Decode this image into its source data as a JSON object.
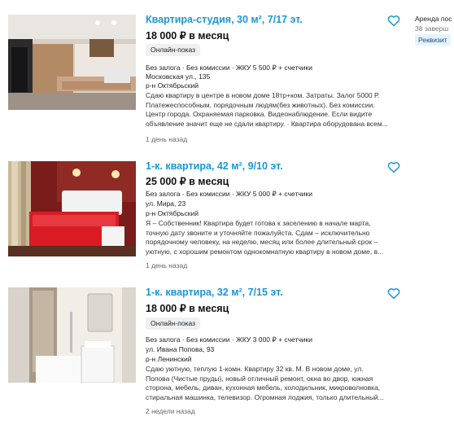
{
  "listings": [
    {
      "title": "Квартира-студия, 30 м², 7/17 эт.",
      "price": "18 000 ₽ в месяц",
      "badge": "Онлайн-показ",
      "terms": "Без залога · Без комиссии · ЖКУ 5 500 ₽ + счетчики",
      "address": "Московская ул., 135",
      "district": "р-н Октябрьский",
      "description": [
        "Сдаю квартиру в центре в новом доме 18тр+ком. Затраты. Залог 5000 Р.",
        "Платежеспособным, порядочным людям(без животных). Без комиссии.",
        "Центр города. Охраняемая парковка. Видеонаблюдение. Если видите",
        "объявление значит еще не сдали квартиру. · Квартира оборудована всем..."
      ],
      "time_ago": "1 день назад",
      "favorite_icon": "heart-outline-icon"
    },
    {
      "title": "1-к. квартира, 42 м², 9/10 эт.",
      "price": "25 000 ₽ в месяц",
      "terms": "Без залога · Без комиссии · ЖКУ 5 000 ₽ + счетчики",
      "address": "ул. Мира, 23",
      "district": "р-н Октябрьский",
      "description": [
        "Я – Собственник! Квартира будет готова к заселению в начале марта,",
        "точную дату звоните и уточняйте пожалуйста. Сдам – исключительно",
        "порядочному человеку, на неделю, месяц или более длительный срок –",
        "уютную, с хорошим ремонтом однокомнатную квартиру в новом доме, в..."
      ],
      "time_ago": "1 день назад",
      "favorite_icon": "heart-outline-icon"
    },
    {
      "title": "1-к. квартира, 32 м², 7/15 эт.",
      "price": "18 000 ₽ в месяц",
      "badge": "Онлайн-показ",
      "terms": "Без залога · Без комиссии · ЖКУ 3 000 ₽ + счетчики",
      "address": "ул. Ивана Попова, 93",
      "district": "р-н Ленинский",
      "description": [
        "Сдаю уютную, теплую 1-комн. Квартиру 32 кв. М. В новом доме, ул.",
        "Попова (Чистые пруды), новый отличный ремонт, окна во двор, южная",
        "сторона, мебель, диван, кухонная мебель, холодильник, микроволновка,",
        "стиральная машинка, телевизор. Огромная лоджия, только длительный..."
      ],
      "time_ago": "2 недели назад",
      "favorite_icon": "heart-outline-icon"
    }
  ],
  "sidebar": {
    "title": "Аренда пос",
    "subtitle": "38 заверш",
    "badge": "Реквизит"
  },
  "colors": {
    "title_link": "#1a97d6",
    "heart": "#1a97d6",
    "badge_bg": "#eef0f2"
  }
}
